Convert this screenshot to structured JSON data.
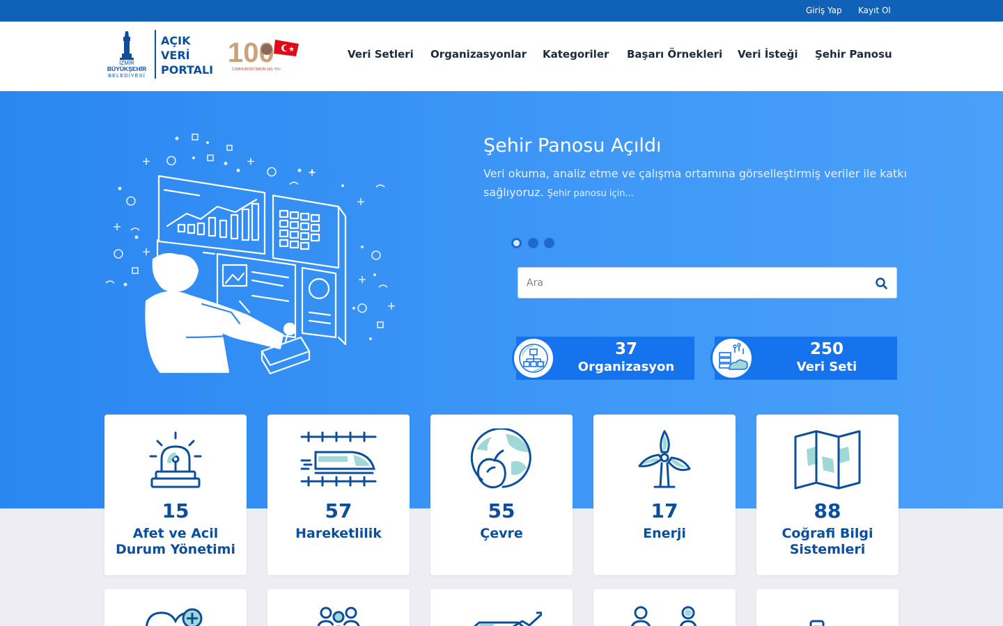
{
  "topbar": {
    "login": "Giriş Yap",
    "register": "Kayıt Ol"
  },
  "logo": {
    "org_line1": "İZMİR",
    "org_line2": "BÜYÜKŞEHİR",
    "org_line3": "BELEDİYESİ",
    "portal_line1": "AÇIK",
    "portal_line2": "VERİ",
    "portal_line3": "PORTALI",
    "centennial": "100",
    "centennial_caption": "CUMHURİYETİMİZİN 100. YILI"
  },
  "nav": [
    "Veri Setleri",
    "Organizasyonlar",
    "Kategoriler",
    "Başarı Örnekleri",
    "Veri İsteği",
    "Şehir Panosu"
  ],
  "hero": {
    "title": "Şehir Panosu Açıldı",
    "text": "Veri okuma, analiz etme ve çalışma ortamına görselleştirmiş veriler ile katkı sağlıyoruz.",
    "more": "Şehir panosu için...",
    "slides": 3,
    "active_slide": 1
  },
  "search": {
    "placeholder": "Ara",
    "icon": "search-icon"
  },
  "stats": [
    {
      "value": "37",
      "label": "Organizasyon",
      "icon": "organization-icon"
    },
    {
      "value": "250",
      "label": "Veri Seti",
      "icon": "dataset-icon"
    }
  ],
  "categories": [
    {
      "count": "15",
      "label": "Afet ve Acil Durum Yönetimi",
      "icon": "siren-icon"
    },
    {
      "count": "57",
      "label": "Hareketlilik",
      "icon": "train-icon"
    },
    {
      "count": "55",
      "label": "Çevre",
      "icon": "globe-leaf-icon"
    },
    {
      "count": "17",
      "label": "Enerji",
      "icon": "wind-turbine-icon"
    },
    {
      "count": "88",
      "label": "Coğrafi Bilgi Sistemleri",
      "icon": "map-icon"
    }
  ],
  "categories_row2_icons": [
    "health-icon",
    "community-icon",
    "economy-icon",
    "people-icon",
    "building-icon"
  ],
  "colors": {
    "topbar": "#0f62b8",
    "hero": "#3e97f7",
    "brand_blue": "#0b4f9c",
    "stat_box": "#1573ee",
    "icon_accent": "#9fd8d6"
  }
}
